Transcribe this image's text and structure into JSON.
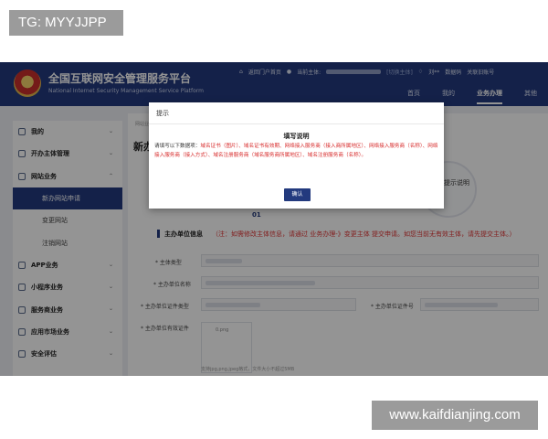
{
  "tags": {
    "top": "TG: MYYJJPP",
    "bottom": "www.kaifdianjing.com"
  },
  "header": {
    "title": "全国互联网安全管理服务平台",
    "subtitle": "National Internet Security Management Service Platform",
    "top_links": {
      "portal": "返回门户首页",
      "subject_label": "当前主体:",
      "switch": "[切换主体]",
      "user": "刘**",
      "data": "数据码",
      "follow": "关联旧账号"
    },
    "nav": [
      "首页",
      "我的",
      "业务办理",
      "其他"
    ],
    "active_nav": "业务办理"
  },
  "sidebar": {
    "items": [
      {
        "label": "我的",
        "type": "group-collapsed",
        "icon": "home-icon"
      },
      {
        "label": "开办主体管理",
        "type": "group-collapsed",
        "icon": "doc-icon"
      },
      {
        "label": "网站业务",
        "type": "group-open",
        "icon": "globe-icon"
      },
      {
        "label": "新办网站申请",
        "type": "sub-active"
      },
      {
        "label": "变更网站",
        "type": "sub"
      },
      {
        "label": "注销网站",
        "type": "sub"
      },
      {
        "label": "APP业务",
        "type": "group-collapsed",
        "icon": "app-icon"
      },
      {
        "label": "小程序业务",
        "type": "group-collapsed",
        "icon": "miniapp-icon"
      },
      {
        "label": "服务商业务",
        "type": "group-collapsed",
        "icon": "server-icon"
      },
      {
        "label": "应用市场业务",
        "type": "group-collapsed",
        "icon": "store-icon"
      },
      {
        "label": "安全评估",
        "type": "group-collapsed",
        "icon": "shield-icon"
      }
    ]
  },
  "main": {
    "breadcrumb": "网站业务 / 新办网站申请",
    "page_title": "新办",
    "step_text": "提示说明",
    "step_num": "01",
    "section_title": "主办单位信息",
    "section_warn": "（注：如需修改主体信息，请通过 业务办理-》变更主体 提交申请。如您当前无有效主体，请先提交主体。）",
    "fields": {
      "type": "* 主体类型",
      "name": "* 主办单位名称",
      "cert_type": "* 主办单位证件类型",
      "cert_no": "* 主办单位证件号",
      "cert_file": "* 主办单位有效证件"
    },
    "upload_note": "0.png",
    "upload_hint": "支持jpg,png,jpeg格式，文件大小不超过5MB"
  },
  "dialog": {
    "head": "提示",
    "title": "填写说明",
    "lead": "请填写以下数据项：",
    "items_text": "域名证书（图片）、域名证书有效期、网络接入服务商（接入商所属地区）、网络接入服务商（名称）、网络接入服务商（接入方式）、域名注册服务商（域名服务商所属地区）、域名注册服务商（名称）。",
    "ok": "确认"
  }
}
